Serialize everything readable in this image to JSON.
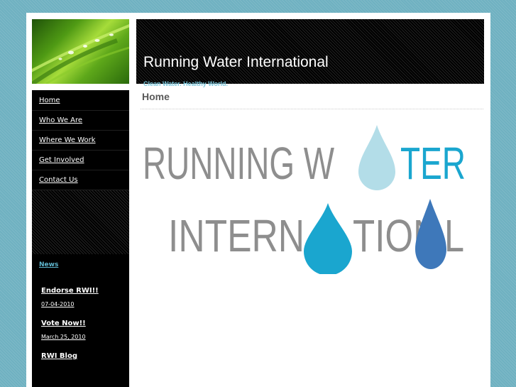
{
  "header": {
    "site_title": "Running Water International",
    "tagline": "Clean Water. Healthy World."
  },
  "nav": {
    "items": [
      {
        "label": "Home"
      },
      {
        "label": "Who We Are"
      },
      {
        "label": "Where We Work"
      },
      {
        "label": "Get Involved"
      },
      {
        "label": "Contact Us"
      }
    ]
  },
  "news": {
    "heading": "News",
    "items": [
      {
        "title": "Endorse RWI!!",
        "date": "07-04-2010"
      },
      {
        "title": "Vote Now!!",
        "date": "March 25, 2010"
      },
      {
        "title": "RWI Blog"
      }
    ]
  },
  "main": {
    "page_heading": "Home",
    "logo": {
      "line1_a": "RUNNING W",
      "line1_b": "TER",
      "line2_a": "INTERN",
      "line2_b": "TION",
      "line2_c": "L"
    }
  },
  "colors": {
    "background": "#6fb1c1",
    "logo_gray": "#8e8e8e",
    "logo_cyan": "#1aa6cf",
    "drop_light": "#b3dde8",
    "drop_blue": "#3e78ba",
    "link_blue": "#5fb7cf"
  },
  "icons": [
    "leaf-photo",
    "water-drop-icon"
  ]
}
